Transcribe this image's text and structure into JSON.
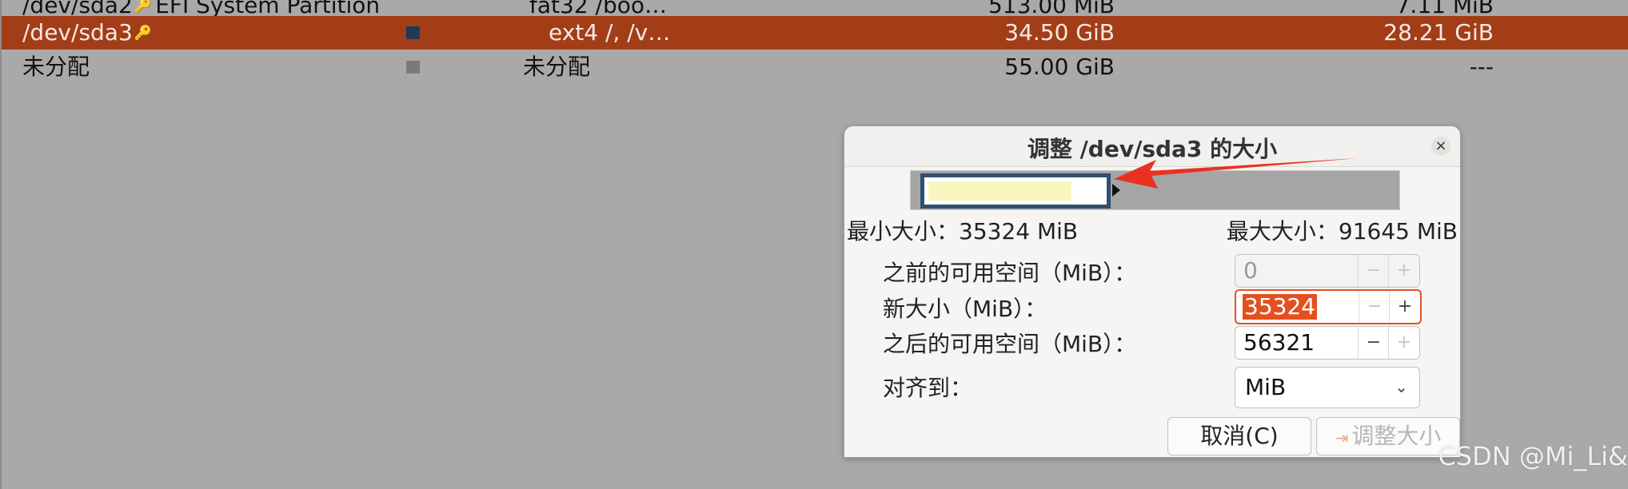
{
  "partitions": [
    {
      "name": "/dev/sda2",
      "key": true,
      "label": "EFI System Partition",
      "filesystem": "fat32 /boo…",
      "size": "513.00 MiB",
      "used": "7.11 MiB",
      "color": null
    },
    {
      "name": "/dev/sda3",
      "key": true,
      "label": "",
      "filesystem": "ext4 /, /v…",
      "size": "34.50 GiB",
      "used": "28.21 GiB",
      "color": "#1e3a56",
      "selected": true
    },
    {
      "name": "未分配",
      "key": false,
      "label": "",
      "filesystem": "未分配",
      "size": "55.00 GiB",
      "used": "---",
      "color": "#7a7a7a"
    }
  ],
  "dialog": {
    "title": "调整 /dev/sda3 的大小",
    "close_icon": "close-icon",
    "graph": {
      "used_fraction": 0.385,
      "partition_fraction": 0.385
    },
    "min_size": "最小大小：35324 MiB",
    "max_size": "最大大小：91645 MiB",
    "fields": {
      "free_before_label": "之前的可用空间（MiB）：",
      "free_before_value": "0",
      "new_size_label": "新大小（MiB）：",
      "new_size_value": "35324",
      "free_after_label": "之后的可用空间（MiB）：",
      "free_after_value": "56321",
      "align_label": "对齐到：",
      "align_value": "MiB"
    },
    "spin_minus": "−",
    "spin_plus": "+",
    "chevron": "⌄",
    "cancel_button": "取消(C)",
    "resize_icon": "⇥",
    "resize_button": "调整大小"
  },
  "colors": {
    "selection": "#a33d17",
    "accent": "#e3501f",
    "annotation_arrow": "#e8321f"
  },
  "watermark": "CSDN @Mi_Li&"
}
